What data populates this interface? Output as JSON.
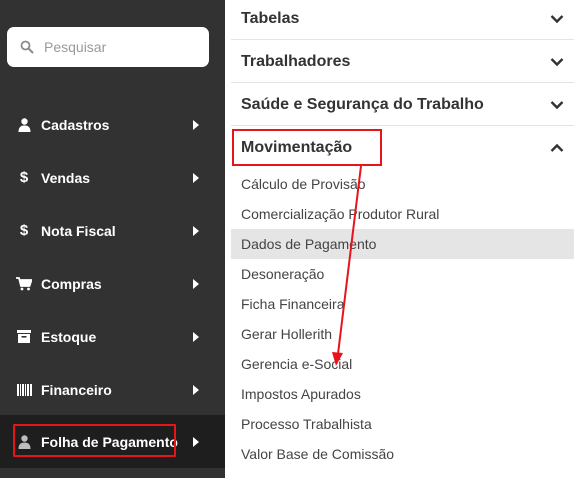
{
  "search": {
    "placeholder": "Pesquisar"
  },
  "sidebar": {
    "items": [
      {
        "label": "Cadastros",
        "icon": "user-icon"
      },
      {
        "label": "Vendas",
        "icon": "dollar-icon"
      },
      {
        "label": "Nota Fiscal",
        "icon": "dollar-icon"
      },
      {
        "label": "Compras",
        "icon": "cart-icon"
      },
      {
        "label": "Estoque",
        "icon": "inbox-icon"
      },
      {
        "label": "Financeiro",
        "icon": "barcode-icon"
      },
      {
        "label": "Folha de Pagamento",
        "icon": "user-icon",
        "active": true
      }
    ]
  },
  "menu": {
    "sections": [
      {
        "title": "Tabelas",
        "expanded": false
      },
      {
        "title": "Trabalhadores",
        "expanded": false
      },
      {
        "title": "Saúde e Segurança do Trabalho",
        "expanded": false
      },
      {
        "title": "Movimentação",
        "expanded": true
      }
    ],
    "movimentacao_items": [
      "Cálculo de Provisão",
      "Comercialização Produtor Rural",
      "Dados de Pagamento",
      "Desoneração",
      "Ficha Financeira",
      "Gerar Hollerith",
      "Gerencia e-Social",
      "Impostos Apurados",
      "Processo Trabalhista",
      "Valor Base de Comissão"
    ],
    "selected_item": "Dados de Pagamento"
  },
  "colors": {
    "sidebar_bg": "#323232",
    "sidebar_active_bg": "#1e1e1e",
    "highlight_red": "#e8141b",
    "selected_row_bg": "#e5e5e5"
  }
}
